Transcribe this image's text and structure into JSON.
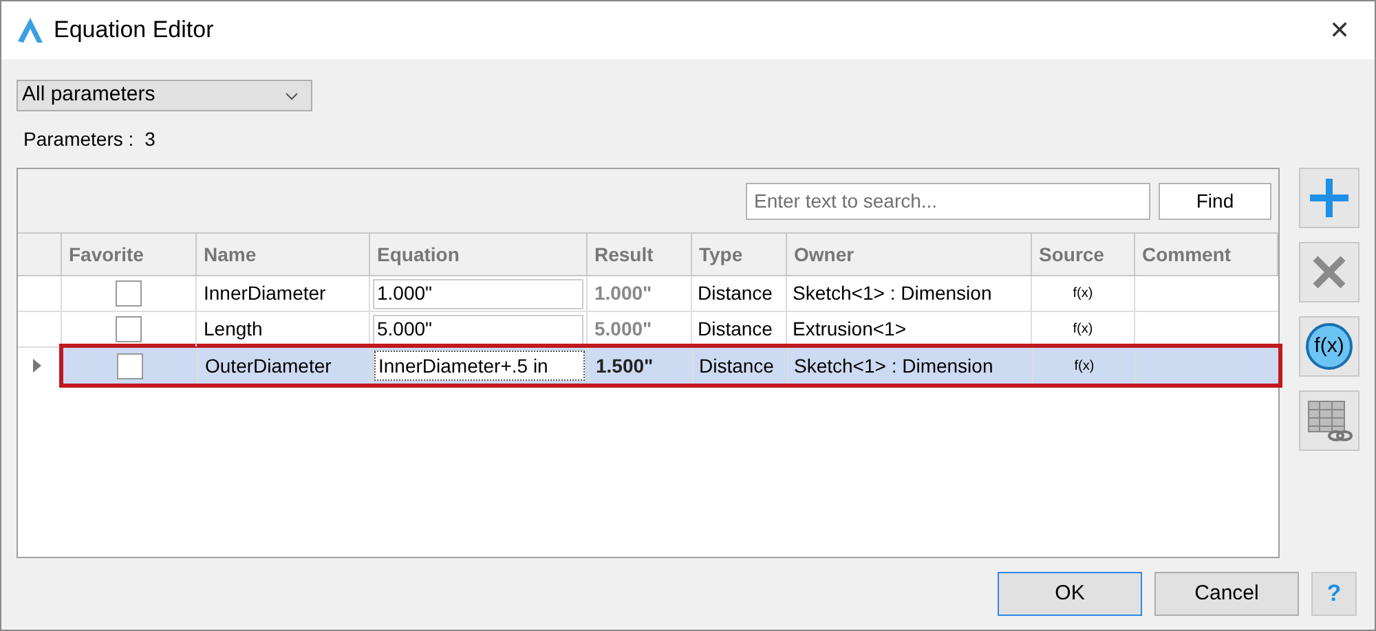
{
  "window": {
    "title": "Equation Editor",
    "close": "✕"
  },
  "filter": {
    "value": "All parameters"
  },
  "parameter_count": {
    "label": "Parameters :",
    "value": "3"
  },
  "search": {
    "placeholder": "Enter text to search...",
    "button": "Find"
  },
  "table": {
    "columns": [
      "Favorite",
      "Name",
      "Equation",
      "Result",
      "Type",
      "Owner",
      "Source",
      "Comment"
    ],
    "rows": [
      {
        "selected": false,
        "favorite": false,
        "name": "InnerDiameter",
        "equation": "1.000\"",
        "result": "1.000\"",
        "type": "Distance",
        "owner": "Sketch<1> : Dimension",
        "source": "f(x)"
      },
      {
        "selected": false,
        "favorite": false,
        "name": "Length",
        "equation": "5.000\"",
        "result": "5.000\"",
        "type": "Distance",
        "owner": "Extrusion<1>",
        "source": "f(x)"
      },
      {
        "selected": true,
        "favorite": false,
        "name": "OuterDiameter",
        "equation": "InnerDiameter+.5 in",
        "result": "1.500\"",
        "type": "Distance",
        "owner": "Sketch<1> : Dimension",
        "source": "f(x)"
      }
    ]
  },
  "side_toolbar": [
    {
      "kind": "add"
    },
    {
      "kind": "delete"
    },
    {
      "kind": "function",
      "label": "f(x)"
    },
    {
      "kind": "link-table"
    }
  ],
  "buttons": [
    {
      "label": "OK",
      "default": true
    },
    {
      "label": "Cancel",
      "default": false
    }
  ],
  "help": "?"
}
